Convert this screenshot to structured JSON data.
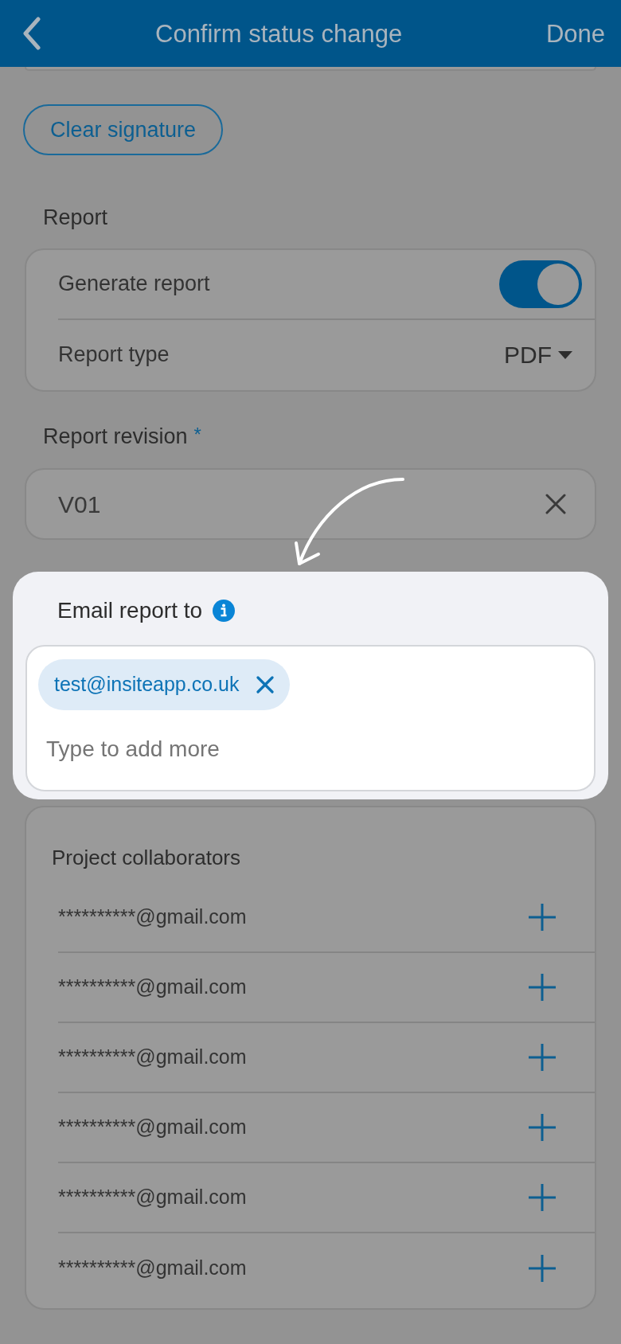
{
  "header": {
    "title": "Confirm status change",
    "done": "Done"
  },
  "clear_signature": "Clear signature",
  "report": {
    "label": "Report",
    "generate_report": {
      "label": "Generate report",
      "on": true
    },
    "report_type": {
      "label": "Report type",
      "value": "PDF"
    }
  },
  "report_revision": {
    "label": "Report revision",
    "required_mark": "*",
    "value": "V01"
  },
  "email_report_to": {
    "label": "Email report to",
    "recipients": [
      "test@insiteapp.co.uk"
    ],
    "placeholder": "Type to add more"
  },
  "project_collaborators": {
    "title": "Project collaborators",
    "emails": [
      "**********@gmail.com",
      "**********@gmail.com",
      "**********@gmail.com",
      "**********@gmail.com",
      "**********@gmail.com",
      "**********@gmail.com"
    ]
  }
}
